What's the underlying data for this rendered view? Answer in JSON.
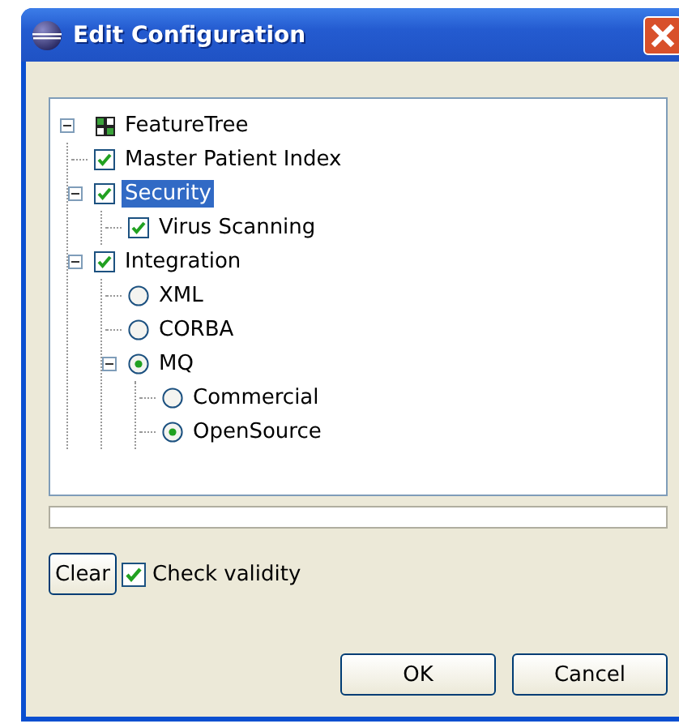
{
  "window": {
    "title": "Edit Configuration"
  },
  "tree": {
    "label": "FeatureTree",
    "kind": "root",
    "expanded": true,
    "selected": false,
    "children": [
      {
        "label": "Master Patient Index",
        "kind": "checkbox",
        "checked": true,
        "selected": false
      },
      {
        "label": "Security",
        "kind": "checkbox",
        "checked": true,
        "selected": true,
        "expanded": true,
        "children": [
          {
            "label": "Virus Scanning",
            "kind": "checkbox",
            "checked": true,
            "selected": false
          }
        ]
      },
      {
        "label": "Integration",
        "kind": "checkbox",
        "checked": true,
        "selected": false,
        "expanded": true,
        "children": [
          {
            "label": "XML",
            "kind": "radio",
            "checked": false,
            "selected": false
          },
          {
            "label": "CORBA",
            "kind": "radio",
            "checked": false,
            "selected": false
          },
          {
            "label": "MQ",
            "kind": "radio",
            "checked": true,
            "selected": false,
            "expanded": true,
            "children": [
              {
                "label": "Commercial",
                "kind": "radio",
                "checked": false,
                "selected": false
              },
              {
                "label": "OpenSource",
                "kind": "radio",
                "checked": true,
                "selected": false
              }
            ]
          }
        ]
      }
    ]
  },
  "clear_button": "Clear",
  "check_validity": {
    "label": "Check validity",
    "checked": true
  },
  "buttons": [
    "OK",
    "Cancel"
  ]
}
